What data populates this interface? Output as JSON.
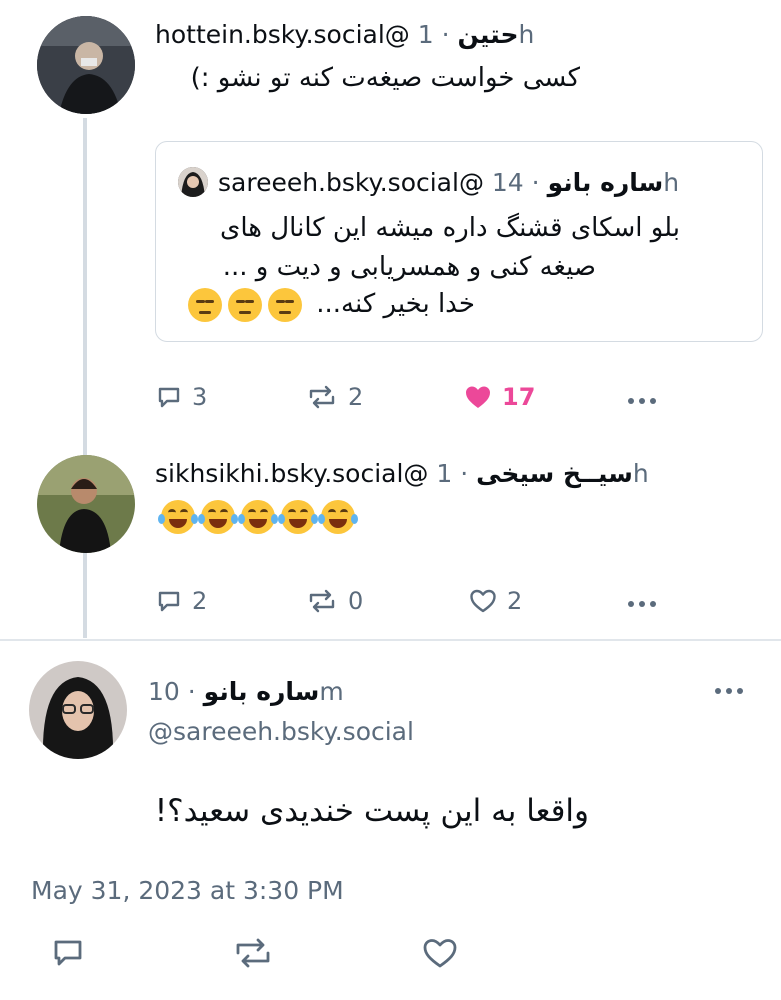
{
  "posts": [
    {
      "handle": "hottein.bsky.social@",
      "name": "حتین",
      "time": "1h",
      "text": "کسی خواست صیغه‌ت کنه تو نشو :)",
      "quote": {
        "handle": "sareeeh.bsky.social@",
        "name": "ساره بانو",
        "time": "14h",
        "line1": "بلو اسکای قشنگ داره میشه این کانال های",
        "line2": "صیغه کنی و همسریابی و دیت و ...",
        "line3": "خدا بخیر کنه..."
      },
      "replies": "3",
      "reposts": "2",
      "likes": "17"
    },
    {
      "handle": "sikhsikhi.bsky.social@",
      "name": "سیــخ سیخی",
      "time": "1h",
      "replies": "2",
      "reposts": "0",
      "likes": "2"
    }
  ],
  "main": {
    "name": "ساره بانو",
    "time": "10m",
    "handle": "@sareeeh.bsky.social",
    "text": "واقعا به این پست خندیدی سعید؟!",
    "timestamp": "May 31, 2023 at 3:30 PM"
  },
  "separator": "·",
  "colors": {
    "like": "#ec4899",
    "muted": "#5b6b7c",
    "line": "#d4dbe2"
  }
}
